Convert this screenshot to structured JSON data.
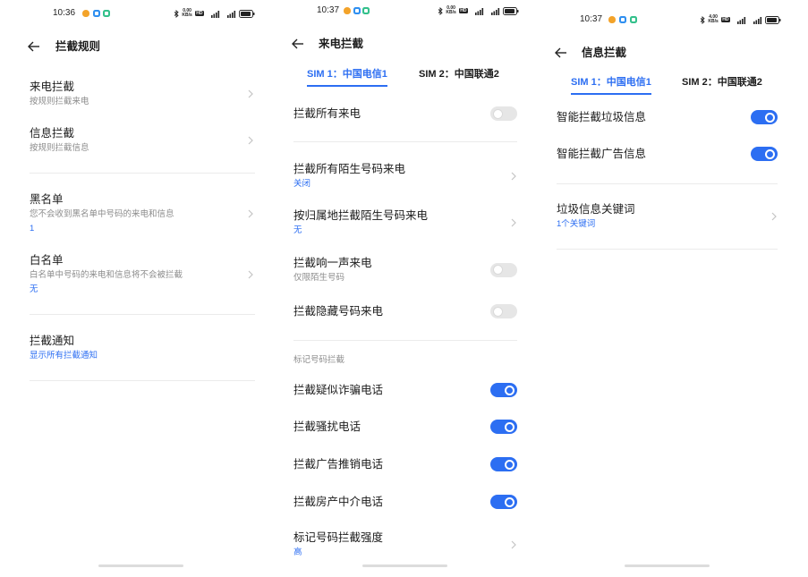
{
  "colors": {
    "accent": "#2c6ef2",
    "text": "#1b1b1b",
    "secondary_text": "#8c8c8c",
    "divider": "#ebebeb",
    "toggle_off": "#e6e6e6"
  },
  "icons": {
    "back": "back-arrow-icon",
    "chevron": "chevron-right-icon",
    "bluetooth": "bluetooth-icon",
    "hd": "hd-voice-icon",
    "signal": "signal-strength-icon",
    "battery": "battery-icon",
    "notification": "app-notification-icon"
  },
  "screens": {
    "rules": {
      "status_bar": {
        "time": "10:36",
        "net_speed": "0.00",
        "net_speed_unit": "KB/s",
        "hd_label": "HD"
      },
      "title": "拦截规则",
      "items": [
        {
          "title": "来电拦截",
          "subtitle": "按规则拦截来电"
        },
        {
          "title": "信息拦截",
          "subtitle": "按规则拦截信息"
        },
        {
          "title": "黑名单",
          "subtitle": "您不会收到黑名单中号码的来电和信息",
          "value": "1"
        },
        {
          "title": "白名单",
          "subtitle": "白名单中号码的来电和信息将不会被拦截",
          "value": "无"
        },
        {
          "title": "拦截通知",
          "value": "显示所有拦截通知"
        }
      ]
    },
    "calls": {
      "status_bar": {
        "time": "10:37",
        "net_speed": "0.00",
        "net_speed_unit": "KB/s",
        "hd_label": "HD"
      },
      "title": "来电拦截",
      "tabs": [
        {
          "label": "SIM 1：中国电信1",
          "active": true
        },
        {
          "label": "SIM 2：中国联通2",
          "active": false
        }
      ],
      "items": [
        {
          "title": "拦截所有来电",
          "enabled": false
        },
        {
          "title": "拦截所有陌生号码来电",
          "value": "关闭"
        },
        {
          "title": "按归属地拦截陌生号码来电",
          "value": "无"
        },
        {
          "title": "拦截响一声来电",
          "subtitle": "仅限陌生号码",
          "enabled": false
        },
        {
          "title": "拦截隐藏号码来电",
          "enabled": false
        }
      ],
      "section_label": "标记号码拦截",
      "marked_items": [
        {
          "title": "拦截疑似诈骗电话",
          "enabled": true
        },
        {
          "title": "拦截骚扰电话",
          "enabled": true
        },
        {
          "title": "拦截广告推销电话",
          "enabled": true
        },
        {
          "title": "拦截房产中介电话",
          "enabled": true
        },
        {
          "title": "标记号码拦截强度",
          "value": "高"
        }
      ]
    },
    "messages": {
      "status_bar": {
        "time": "10:37",
        "net_speed": "4.00",
        "net_speed_unit": "KB/s",
        "hd_label": "HD"
      },
      "title": "信息拦截",
      "tabs": [
        {
          "label": "SIM 1：中国电信1",
          "active": true
        },
        {
          "label": "SIM 2：中国联通2",
          "active": false
        }
      ],
      "items": [
        {
          "title": "智能拦截垃圾信息",
          "enabled": true
        },
        {
          "title": "智能拦截广告信息",
          "enabled": true
        },
        {
          "title": "垃圾信息关键词",
          "value": "1个关键词"
        }
      ]
    }
  }
}
